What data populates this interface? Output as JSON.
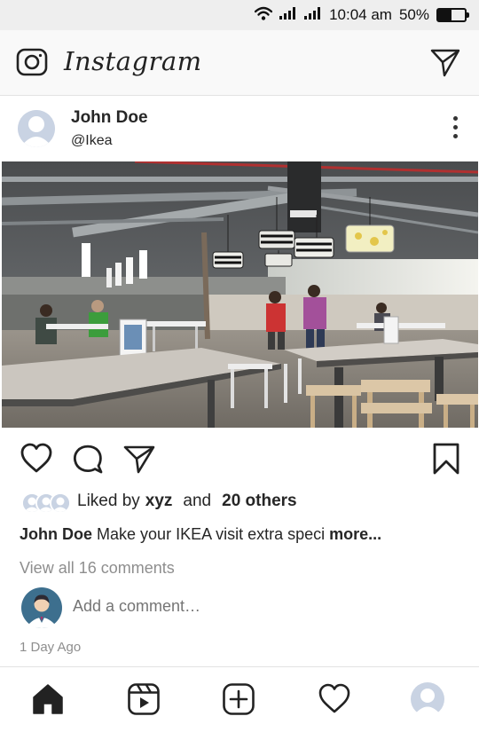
{
  "status_bar": {
    "time": "10:04 am",
    "battery_text": "50%",
    "battery_level": 0.5,
    "icons": [
      "wifi-icon",
      "signal-icon",
      "signal-icon",
      "battery-icon"
    ]
  },
  "header": {
    "app_title": "Instagram",
    "icons": [
      "camera-icon",
      "direct-message-icon"
    ]
  },
  "post": {
    "author_name": "John Doe",
    "author_handle": "@Ikea",
    "image_icon": "photo-ikea-food-court",
    "action_icons": [
      "heart-icon",
      "comment-icon",
      "share-icon",
      "bookmark-icon"
    ],
    "likes": {
      "prefix": "Liked by",
      "user": "xyz",
      "connector": "and",
      "others": "20 others"
    },
    "caption": {
      "author": "John Doe",
      "text": "Make your IKEA visit extra speci",
      "more": "more..."
    },
    "view_comments": "View all 16 comments",
    "add_comment_placeholder": "Add a comment…",
    "time_ago": "1 Day Ago"
  },
  "bottom_nav": {
    "icons": [
      "home-icon",
      "reels-icon",
      "new-post-icon",
      "activity-heart-icon",
      "profile-avatar"
    ]
  },
  "colors": {
    "text": "#262626",
    "muted": "#8e8e8e",
    "avatar_placeholder": "#c9d3e3",
    "status_bar_bg": "#eeeeee"
  }
}
